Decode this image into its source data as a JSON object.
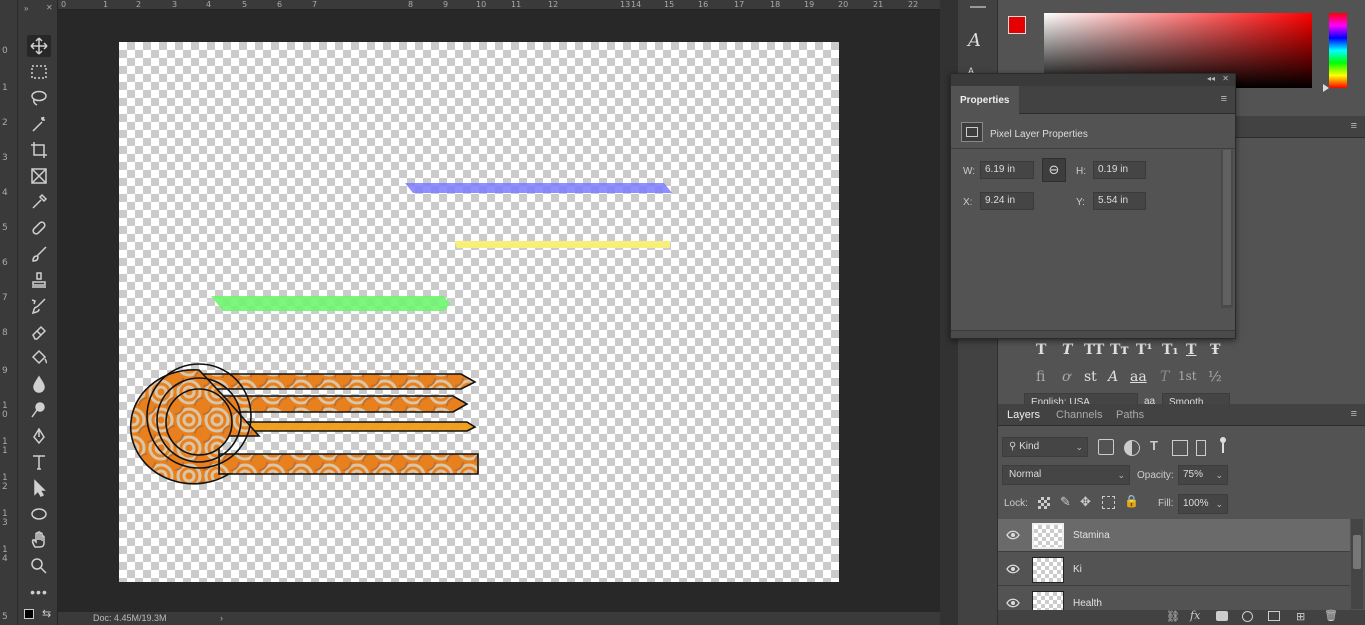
{
  "rulers": {
    "vertical": [
      "0",
      "1",
      "2",
      "3",
      "4",
      "5",
      "6",
      "7",
      "8",
      "9",
      "1 0",
      "1 1",
      "1 2",
      "1 3",
      "1 4",
      "5"
    ],
    "horizontal": [
      "0",
      "1",
      "2",
      "3",
      "4",
      "5",
      "6",
      "7",
      "8",
      "9",
      "10",
      "11",
      "12",
      "13",
      "14",
      "15",
      "16",
      "17",
      "18",
      "19",
      "20",
      "21",
      "22"
    ]
  },
  "status": {
    "doc": "Doc: 4.45M/19.3M"
  },
  "colors": {
    "foreground": "#e60000",
    "background": "#cc2222",
    "accent": "#ff0000"
  },
  "properties": {
    "tab": "Properties",
    "section": "Pixel Layer Properties",
    "w_label": "W:",
    "w_value": "6.19 in",
    "h_label": "H:",
    "h_value": "0.19 in",
    "x_label": "X:",
    "x_value": "9.24 in",
    "y_label": "Y:",
    "y_value": "5.54 in"
  },
  "character": {
    "language": "English: USA",
    "aa_label": "aa",
    "antialias": "Smooth",
    "glyph_row1": [
      "T",
      "T",
      "TT",
      "Tт",
      "T¹",
      "T₁",
      "T",
      "Ŧ"
    ],
    "glyph_row2": [
      "fi",
      "ơ",
      "st",
      "A",
      "aa",
      "T",
      "1st",
      "½"
    ]
  },
  "layers_panel": {
    "tabs": [
      "Layers",
      "Channels",
      "Paths"
    ],
    "filter_kind": "Kind",
    "blend_mode": "Normal",
    "opacity_label": "Opacity:",
    "opacity_value": "75%",
    "lock_label": "Lock:",
    "fill_label": "Fill:",
    "fill_value": "100%",
    "layers": [
      {
        "name": "Stamina",
        "selected": true
      },
      {
        "name": "Ki",
        "selected": false
      },
      {
        "name": "Health",
        "selected": false
      }
    ]
  },
  "canvas_bars": {
    "blue": "#7b7bff",
    "yellow": "#f6f07a",
    "green": "#6ef56e",
    "orange": "#e8801e"
  },
  "icons": {
    "move": "move-icon",
    "marquee": "marquee-icon",
    "lasso": "lasso-icon",
    "wand": "magic-wand-icon",
    "crop": "crop-icon",
    "frame": "frame-icon",
    "eyedropper": "eyedropper-icon",
    "healing": "healing-icon",
    "brush": "brush-icon",
    "stamp": "stamp-icon",
    "history": "history-brush-icon",
    "eraser": "eraser-icon",
    "bucket": "bucket-icon",
    "blur": "blur-icon",
    "dodge": "dodge-icon",
    "pen": "pen-icon",
    "type": "type-icon",
    "path": "path-select-icon",
    "shape": "ellipse-icon",
    "hand": "hand-icon",
    "zoom": "zoom-icon",
    "more": "more-icon"
  }
}
